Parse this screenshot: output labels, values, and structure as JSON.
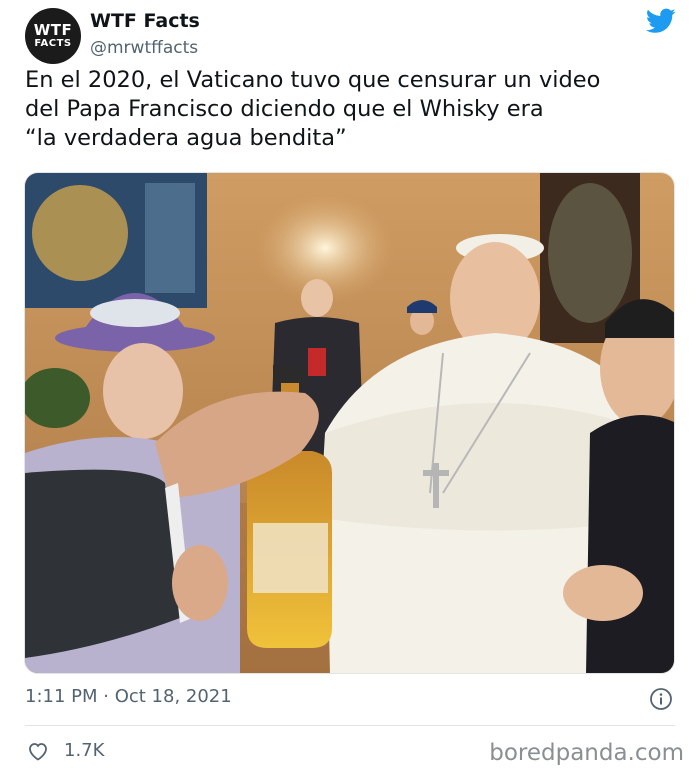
{
  "author": {
    "avatar_line1": "WTF",
    "avatar_line2": "FACTS",
    "display_name": "WTF Facts",
    "handle": "@mrwtffacts"
  },
  "tweet": {
    "text": "En el 2020, el Vaticano tuvo que censurar un video\ndel Papa Francisco diciendo que el Whisky era\n“la verdadera agua bendita”",
    "timestamp": "1:11 PM · Oct 18, 2021",
    "like_count": "1.7K"
  },
  "icons": {
    "brand": "twitter-bird-icon",
    "info": "info-icon",
    "like": "heart-icon"
  },
  "colors": {
    "twitter_blue": "#1d9bf0",
    "secondary_text": "#536471",
    "watermark": "#8a8f93"
  },
  "watermark": "boredpanda.com"
}
